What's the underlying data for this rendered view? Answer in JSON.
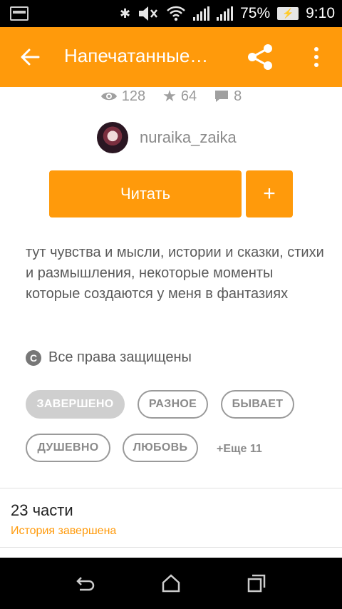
{
  "status_bar": {
    "battery_percent": "75%",
    "time": "9:10",
    "icons": [
      "image-icon",
      "bluetooth-icon",
      "mute-icon",
      "wifi-icon",
      "signal-icon",
      "signal-icon",
      "battery-charging-icon"
    ]
  },
  "app_bar": {
    "title": "Напечатанные…",
    "icons": [
      "back-arrow-icon",
      "share-icon",
      "more-vert-icon"
    ]
  },
  "stats": {
    "views": "128",
    "stars": "64",
    "comments": "8"
  },
  "author": {
    "name": "nuraika_zaika"
  },
  "actions": {
    "read_label": "Читать",
    "add_label": "+"
  },
  "description": "тут чувства и мысли, истории и сказки, стихи и размышления, некоторые моменты которые создаются у меня в фантазиях",
  "copyright": {
    "symbol": "C",
    "text": "Все права защищены"
  },
  "tags": [
    "ЗАВЕРШЕНО",
    "РАЗНОЕ",
    "БЫВАЕТ",
    "ДУШЕВНО",
    "ЛЮБОВЬ"
  ],
  "more_tags": "+Еще 11",
  "parts": {
    "count_text": "23 части",
    "status_text": "История завершена"
  },
  "colors": {
    "accent": "#ff9a0b",
    "tag_active_bg": "#cfcfcf"
  },
  "nav_bar": {
    "icons": [
      "back-nav-icon",
      "home-icon",
      "recents-icon"
    ]
  }
}
